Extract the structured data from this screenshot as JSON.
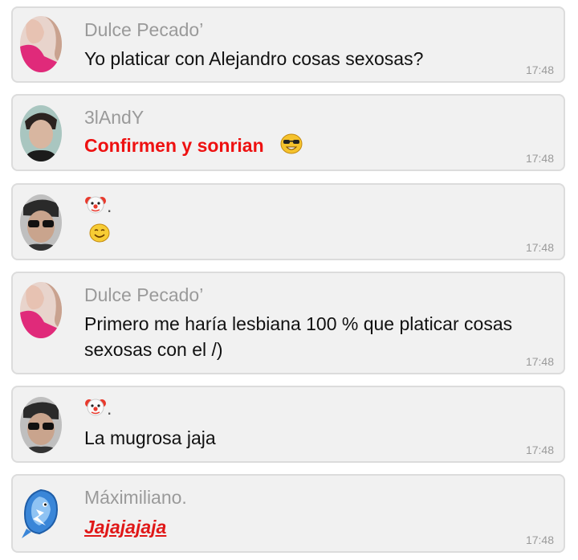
{
  "messages": [
    {
      "author": "Dulce Pecado’",
      "text": "Yo platicar con Alejandro cosas sexosas?",
      "time": "17:48",
      "avatar": "pink-woman-avatar"
    },
    {
      "author": "3lAndY",
      "text": "Confirmen y sonrian",
      "time": "17:48",
      "avatar": "young-man-avatar",
      "emoji": "sunglasses-grin-emoji"
    },
    {
      "text_suffix": ".",
      "time": "17:48",
      "avatar": "man-sunglasses-avatar",
      "emoji1": "clown-emoji",
      "emoji2": "smiling-face-emoji"
    },
    {
      "author": "Dulce Pecado’",
      "text": "Primero me haría lesbiana 100 % que platicar cosas sexosas con el /)",
      "time": "17:48",
      "avatar": "pink-woman-avatar"
    },
    {
      "text_suffix": ".",
      "text": "La mugrosa jaja",
      "time": "17:48",
      "avatar": "man-sunglasses-avatar",
      "emoji1": "clown-emoji"
    },
    {
      "author": "Máximiliano.",
      "text": "Jajajajaja",
      "time": "17:48",
      "avatar": "blue-bird-avatar"
    }
  ],
  "colors": {
    "bubble": "#f1f1f1",
    "border": "#dcdcdc",
    "name": "#9a9a9a",
    "red_text": "#ee1111"
  }
}
